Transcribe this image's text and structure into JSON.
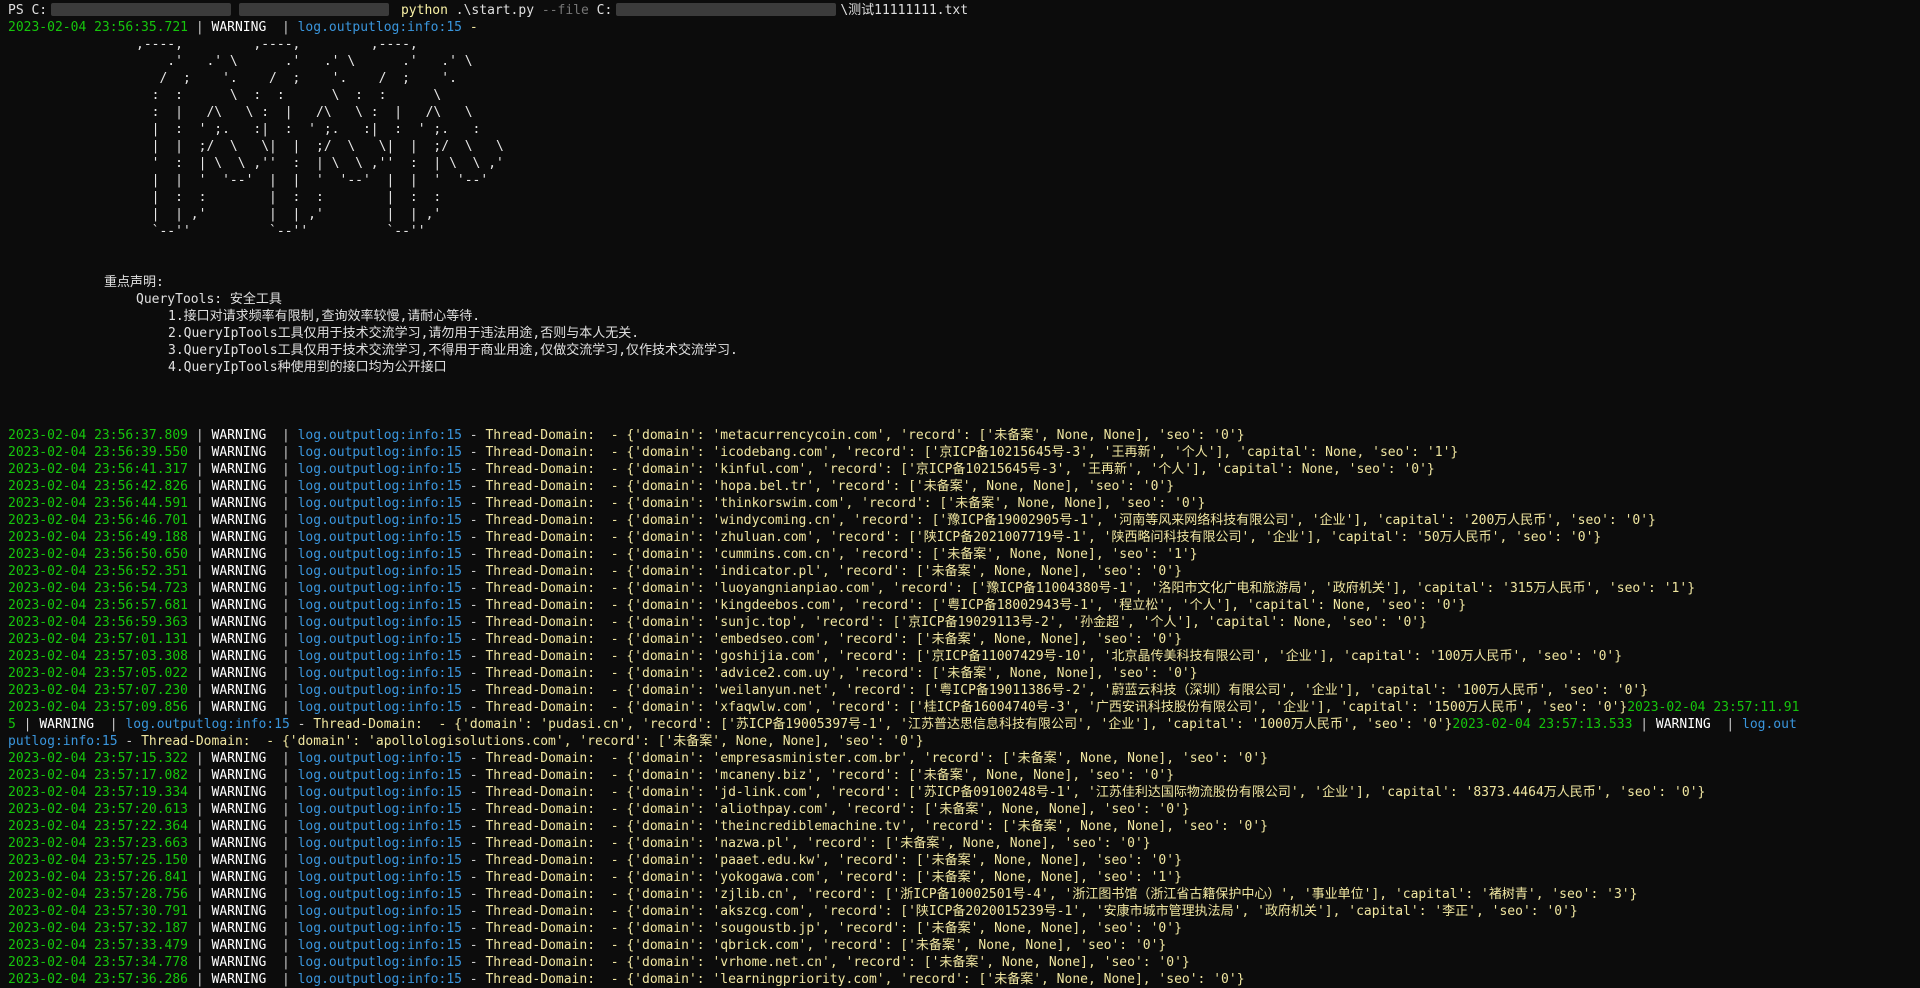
{
  "prompt": {
    "ps": "PS C:",
    "command": "python",
    "script": ".\\start.py",
    "flag": "--file",
    "drive": "C:",
    "file": "\\测试11111111.txt"
  },
  "first_log": {
    "ts": "2023-02-04 23:56:35.721",
    "level": "WARNING",
    "module": "log.outputlog:info:15",
    "message": "-"
  },
  "ascii_art": [
    ",----,         ,----,         ,----,",
    "    .'   .' \\      .'   .' \\      .'   .' \\",
    "   /  ;    '.    /  ;    '.    /  ;    '.",
    "  :  :      \\  :  :      \\  :  :      \\",
    "  :  |   /\\   \\ :  |   /\\   \\ :  |   /\\   \\",
    "  |  :  ' ;.   :|  :  ' ;.   :|  :  ' ;.   :",
    "  |  |  ;/  \\   \\|  |  ;/  \\   \\|  |  ;/  \\   \\",
    "  '  :  | \\  \\ ,''  :  | \\  \\ ,''  :  | \\  \\ ,'",
    "  |  |  '  '--'  |  |  '  '--'  |  |  '  '--'",
    "  |  :  :        |  :  :        |  :  :",
    "  |  | ,'        |  | ,'        |  | ,'",
    "  `--''          `--''          `--''"
  ],
  "notice": {
    "heading": "重点声明:",
    "tool": "QueryTools: 安全工具",
    "items": [
      "1.接口对请求频率有限制,查询效率较慢,请耐心等待.",
      "2.QueryIpTools工具仅用于技术交流学习,请勿用于违法用途,否则与本人无关.",
      "3.QueryIpTools工具仅用于技术交流学习,不得用于商业用途,仅做交流学习,仅作技术交流学习.",
      "4.QueryIpTools种使用到的接口均为公开接口"
    ]
  },
  "logs_a": [
    {
      "ts": "2023-02-04 23:56:37.809",
      "msg": "Thread-Domain:  - {'domain': 'metacurrencycoin.com', 'record': ['未备案', None, None], 'seo': '0'}"
    },
    {
      "ts": "2023-02-04 23:56:39.550",
      "msg": "Thread-Domain:  - {'domain': 'icodebang.com', 'record': ['京ICP备10215645号-3', '王再新', '个人'], 'capital': None, 'seo': '1'}"
    },
    {
      "ts": "2023-02-04 23:56:41.317",
      "msg": "Thread-Domain:  - {'domain': 'kinful.com', 'record': ['京ICP备10215645号-3', '王再新', '个人'], 'capital': None, 'seo': '0'}"
    },
    {
      "ts": "2023-02-04 23:56:42.826",
      "msg": "Thread-Domain:  - {'domain': 'hopa.bel.tr', 'record': ['未备案', None, None], 'seo': '0'}"
    },
    {
      "ts": "2023-02-04 23:56:44.591",
      "msg": "Thread-Domain:  - {'domain': 'thinkorswim.com', 'record': ['未备案', None, None], 'seo': '0'}"
    },
    {
      "ts": "2023-02-04 23:56:46.701",
      "msg": "Thread-Domain:  - {'domain': 'windycoming.cn', 'record': ['豫ICP备19002905号-1', '河南等风来网络科技有限公司', '企业'], 'capital': '200万人民币', 'seo': '0'}"
    },
    {
      "ts": "2023-02-04 23:56:49.188",
      "msg": "Thread-Domain:  - {'domain': 'zhuluan.com', 'record': ['陕ICP备2021007719号-1', '陕西略问科技有限公司', '企业'], 'capital': '50万人民币', 'seo': '0'}"
    },
    {
      "ts": "2023-02-04 23:56:50.650",
      "msg": "Thread-Domain:  - {'domain': 'cummins.com.cn', 'record': ['未备案', None, None], 'seo': '1'}"
    },
    {
      "ts": "2023-02-04 23:56:52.351",
      "msg": "Thread-Domain:  - {'domain': 'indicator.pl', 'record': ['未备案', None, None], 'seo': '0'}"
    },
    {
      "ts": "2023-02-04 23:56:54.723",
      "msg": "Thread-Domain:  - {'domain': 'luoyangnianpiao.com', 'record': ['豫ICP备11004380号-1', '洛阳市文化广电和旅游局', '政府机关'], 'capital': '315万人民币', 'seo': '1'}"
    },
    {
      "ts": "2023-02-04 23:56:57.681",
      "msg": "Thread-Domain:  - {'domain': 'kingdeebos.com', 'record': ['粤ICP备18002943号-1', '程立松', '个人'], 'capital': None, 'seo': '0'}"
    },
    {
      "ts": "2023-02-04 23:56:59.363",
      "msg": "Thread-Domain:  - {'domain': 'sunjc.top', 'record': ['京ICP备19029113号-2', '孙金超', '个人'], 'capital': None, 'seo': '0'}"
    },
    {
      "ts": "2023-02-04 23:57:01.131",
      "msg": "Thread-Domain:  - {'domain': 'embedseo.com', 'record': ['未备案', None, None], 'seo': '0'}"
    },
    {
      "ts": "2023-02-04 23:57:03.308",
      "msg": "Thread-Domain:  - {'domain': 'goshijia.com', 'record': ['京ICP备11007429号-10', '北京晶传美科技有限公司', '企业'], 'capital': '100万人民币', 'seo': '0'}"
    },
    {
      "ts": "2023-02-04 23:57:05.022",
      "msg": "Thread-Domain:  - {'domain': 'advice2.com.uy', 'record': ['未备案', None, None], 'seo': '0'}"
    },
    {
      "ts": "2023-02-04 23:57:07.230",
      "msg": "Thread-Domain:  - {'domain': 'weilanyun.net', 'record': ['粤ICP备19011386号-2', '蔚蓝云科技（深圳）有限公司', '企业'], 'capital': '100万人民币', 'seo': '0'}"
    }
  ],
  "wrapped": {
    "l1_ts": "2023-02-04 23:57:09.856",
    "l1_msg": "Thread-Domain:  - {'domain': 'xfaqwlw.com', 'record': ['桂ICP备16004740号-3', '广西安讯科技股份有限公司', '企业'], 'capital': '1500万人民币', 'seo': '0'}",
    "l1_tail": "2023-02-04 23:57:11.91",
    "l2_head": "5",
    "l2_mod": "log.outputlog:info:15",
    "l2_msg": "Thread-Domain:  - {'domain': 'pudasi.cn', 'record': ['苏ICP备19005397号-1', '江苏普达思信息科技有限公司', '企业'], 'capital': '1000万人民币', 'seo': '0'}",
    "l2_ts2": "2023-02-04 23:57:13.533",
    "l2_mod_tail": "log.out",
    "l3_mod_head": "putlog:info:15",
    "l3_msg": "Thread-Domain:  - {'domain': 'apollologisolutions.com', 'record': ['未备案', None, None], 'seo': '0'}"
  },
  "logs_b": [
    {
      "ts": "2023-02-04 23:57:15.322",
      "msg": "Thread-Domain:  - {'domain': 'empresasminister.com.br', 'record': ['未备案', None, None], 'seo': '0'}"
    },
    {
      "ts": "2023-02-04 23:57:17.082",
      "msg": "Thread-Domain:  - {'domain': 'mcaneny.biz', 'record': ['未备案', None, None], 'seo': '0'}"
    },
    {
      "ts": "2023-02-04 23:57:19.334",
      "msg": "Thread-Domain:  - {'domain': 'jd-link.com', 'record': ['苏ICP备09100248号-1', '江苏佳利达国际物流股份有限公司', '企业'], 'capital': '8373.4464万人民币', 'seo': '0'}"
    },
    {
      "ts": "2023-02-04 23:57:20.613",
      "msg": "Thread-Domain:  - {'domain': 'aliothpay.com', 'record': ['未备案', None, None], 'seo': '0'}"
    },
    {
      "ts": "2023-02-04 23:57:22.364",
      "msg": "Thread-Domain:  - {'domain': 'theincrediblemachine.tv', 'record': ['未备案', None, None], 'seo': '0'}"
    },
    {
      "ts": "2023-02-04 23:57:23.663",
      "msg": "Thread-Domain:  - {'domain': 'nazwa.pl', 'record': ['未备案', None, None], 'seo': '0'}"
    },
    {
      "ts": "2023-02-04 23:57:25.150",
      "msg": "Thread-Domain:  - {'domain': 'paaet.edu.kw', 'record': ['未备案', None, None], 'seo': '0'}"
    },
    {
      "ts": "2023-02-04 23:57:26.841",
      "msg": "Thread-Domain:  - {'domain': 'yokogawa.com', 'record': ['未备案', None, None], 'seo': '1'}"
    },
    {
      "ts": "2023-02-04 23:57:28.756",
      "msg": "Thread-Domain:  - {'domain': 'zjlib.cn', 'record': ['浙ICP备10002501号-4', '浙江图书馆（浙江省古籍保护中心）', '事业单位'], 'capital': '褚树青', 'seo': '3'}"
    },
    {
      "ts": "2023-02-04 23:57:30.791",
      "msg": "Thread-Domain:  - {'domain': 'akszcg.com', 'record': ['陕ICP备2020015239号-1', '安康市城市管理执法局', '政府机关'], 'capital': '李正', 'seo': '0'}"
    },
    {
      "ts": "2023-02-04 23:57:32.187",
      "msg": "Thread-Domain:  - {'domain': 'sougoustb.jp', 'record': ['未备案', None, None], 'seo': '0'}"
    },
    {
      "ts": "2023-02-04 23:57:33.479",
      "msg": "Thread-Domain:  - {'domain': 'qbrick.com', 'record': ['未备案', None, None], 'seo': '0'}"
    },
    {
      "ts": "2023-02-04 23:57:34.778",
      "msg": "Thread-Domain:  - {'domain': 'vrhome.net.cn', 'record': ['未备案', None, None], 'seo': '0'}"
    },
    {
      "ts": "2023-02-04 23:57:36.286",
      "msg": "Thread-Domain:  - {'domain': 'learningpriority.com', 'record': ['未备案', None, None], 'seo': '0'}"
    }
  ],
  "common": {
    "level": "WARNING",
    "module": "log.outputlog:info:15",
    "pipe": " | ",
    "pipe2": "  | "
  }
}
